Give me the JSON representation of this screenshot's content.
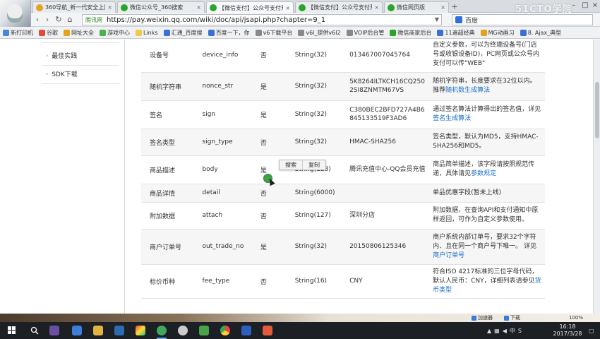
{
  "browser": {
    "tabs": [
      {
        "label": "360导航_新一代安全上网导",
        "icon_color": "#e6a21a",
        "active": false
      },
      {
        "label": "微信公众号_360搜索",
        "icon_color": "#2aa52a",
        "active": false
      },
      {
        "label": "【微信支付】公众号支付开",
        "icon_color": "#2aa52a",
        "active": true
      },
      {
        "label": "【微信支付】公众号支付开",
        "icon_color": "#2aa52a",
        "active": false
      },
      {
        "label": "微信网页版",
        "icon_color": "#2aa52a",
        "active": false
      }
    ],
    "watermark": "51CTO学院",
    "address": {
      "site_tag": "腾讯网",
      "url": "https://pay.weixin.qq.com/wiki/doc/api/jsapi.php?chapter=9_1"
    },
    "search_engine": "百度",
    "bookmarks": [
      {
        "label": "新打印机",
        "color": "#4a86d8"
      },
      {
        "label": "谷歌",
        "color": "#e04c3c"
      },
      {
        "label": "网址大全",
        "color": "#e6a21a"
      },
      {
        "label": "游戏中心",
        "color": "#4caf50"
      },
      {
        "label": "Links",
        "color": "#f2c94c"
      },
      {
        "label": "汇通_百度搜",
        "color": "#3a6fd8"
      },
      {
        "label": "百度一下，你",
        "color": "#3a6fd8"
      },
      {
        "label": "v6下载平台",
        "color": "#888888"
      },
      {
        "label": "v6l_提供v6l2",
        "color": "#888888"
      },
      {
        "label": "VOIP后台管",
        "color": "#888888"
      },
      {
        "label": "微信商家后台",
        "color": "#2aa52a"
      },
      {
        "label": "11遍超经典",
        "color": "#3a6fd8"
      },
      {
        "label": "MG动画习",
        "color": "#e6a21a"
      },
      {
        "label": "8. Ajax_典型",
        "color": "#3a6fd8"
      }
    ]
  },
  "sidebar": {
    "items": [
      {
        "label": "最佳实践"
      },
      {
        "label": "SDK下载"
      }
    ]
  },
  "params_table": {
    "rows": [
      {
        "name": "设备号",
        "field": "device_info",
        "required": "否",
        "type": "String(32)",
        "example": "013467007045764",
        "desc": "自定义参数，可以为终端设备号(门店号或收银设备ID)，PC网页或公众号内支付可以传\"WEB\"",
        "link": ""
      },
      {
        "name": "随机字符串",
        "field": "nonce_str",
        "required": "是",
        "type": "String(32)",
        "example": "5K8264ILTKCH16CQ2502SI8ZNMTM67VS",
        "desc": "随机字符串，长度要求在32位以内。推荐",
        "link": "随机数生成算法"
      },
      {
        "name": "签名",
        "field": "sign",
        "required": "是",
        "type": "String(32)",
        "example": "C380BEC2BFD727A4B6845133519F3AD6",
        "desc": "通过签名算法计算得出的签名值，详见",
        "link": "签名生成算法"
      },
      {
        "name": "签名类型",
        "field": "sign_type",
        "required": "否",
        "type": "String(32)",
        "example": "HMAC-SHA256",
        "desc": "签名类型，默认为MD5，支持HMAC-SHA256和MD5。",
        "link": ""
      },
      {
        "name": "商品描述",
        "field": "body",
        "required": "是",
        "type": "String(128)",
        "example": "腾讯充值中心-QQ会员充值",
        "desc": "商品简单描述，该字段请按照规范传递，具体请见",
        "link": "参数规定"
      },
      {
        "name": "商品详情",
        "field": "detail",
        "required": "否",
        "type": "String(6000)",
        "example": "",
        "desc": "单品优惠字段(暂未上线)",
        "link": ""
      },
      {
        "name": "附加数据",
        "field": "attach",
        "required": "否",
        "type": "String(127)",
        "example": "深圳分店",
        "desc": "附加数据，在查询API和支付通知中原样返回，可作为自定义参数使用。",
        "link": ""
      },
      {
        "name": "商户订单号",
        "field": "out_trade_no",
        "required": "是",
        "type": "String(32)",
        "example": "20150806125346",
        "desc": "商户系统内部订单号，要求32个字符内、且在同一个商户号下唯一。 详见",
        "link": "商户订单号"
      },
      {
        "name": "标价币种",
        "field": "fee_type",
        "required": "否",
        "type": "String(16)",
        "example": "CNY",
        "desc": "符合ISO 4217标准的三位字母代码，默认人民币：CNY，详细列表请参见",
        "link": "货币类型"
      }
    ]
  },
  "context_popover": {
    "search": "搜索",
    "copy": "复制"
  },
  "statusbar": {
    "accelerator": "加速器",
    "download": "下载",
    "zoom": "100%"
  },
  "ime": {
    "mode": "中"
  },
  "taskbar": {
    "time": "16:18",
    "date": "2017/3/28"
  }
}
